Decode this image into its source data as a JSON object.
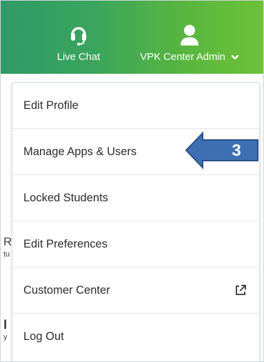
{
  "header": {
    "live_chat_label": "Live Chat",
    "user_label": "VPK Center Admin",
    "gradient_start": "#2f9a66",
    "gradient_end": "#6cc236"
  },
  "menu": {
    "items": [
      {
        "label": "Edit Profile"
      },
      {
        "label": "Manage Apps & Users"
      },
      {
        "label": "Locked Students"
      },
      {
        "label": "Edit Preferences"
      },
      {
        "label": "Customer Center",
        "icon": "external-link-icon"
      },
      {
        "label": "Log Out"
      }
    ]
  },
  "callout": {
    "number": "3",
    "fill": "#3e6fb3",
    "border": "#2b4f87"
  },
  "background_fragments": [
    "R",
    "tu",
    "I",
    "y"
  ]
}
